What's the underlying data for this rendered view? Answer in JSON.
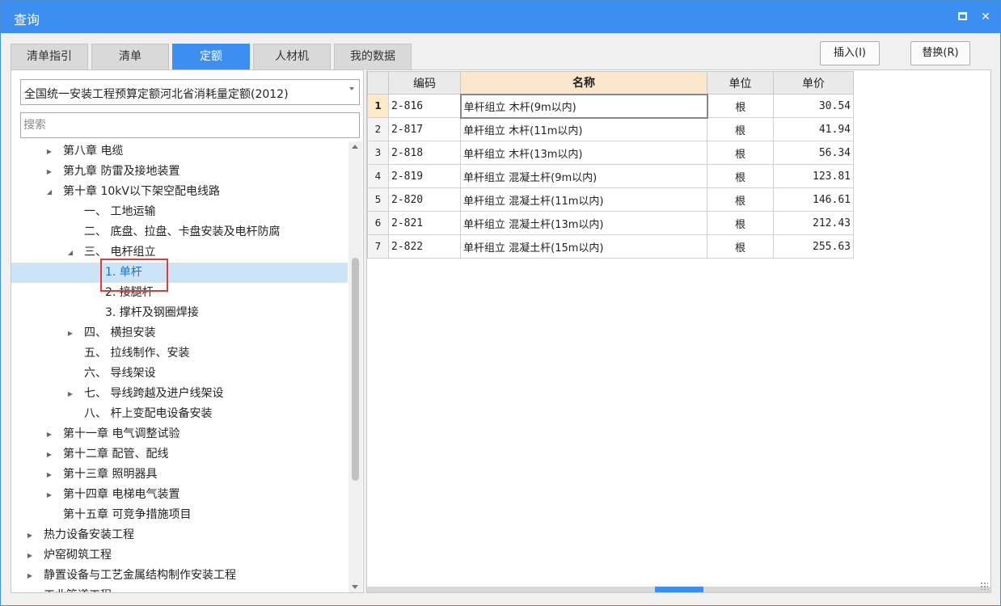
{
  "window": {
    "title": "查询"
  },
  "tabs": [
    {
      "label": "清单指引",
      "active": false
    },
    {
      "label": "清单",
      "active": false
    },
    {
      "label": "定额",
      "active": true
    },
    {
      "label": "人材机",
      "active": false
    },
    {
      "label": "我的数据",
      "active": false
    }
  ],
  "actions": {
    "insert_label": "插入(I)",
    "replace_label": "替换(R)"
  },
  "library": {
    "selected": "全国统一安装工程预算定额河北省消耗量定额(2012)"
  },
  "search": {
    "placeholder": "搜索",
    "value": ""
  },
  "tree": [
    {
      "label": "第八章 电缆",
      "level": 2,
      "toggle": "collapsed"
    },
    {
      "label": "第九章 防雷及接地装置",
      "level": 2,
      "toggle": "collapsed"
    },
    {
      "label": "第十章 10kV以下架空配电线路",
      "level": 2,
      "toggle": "expanded"
    },
    {
      "label": "一、 工地运输",
      "level": 3,
      "toggle": "none"
    },
    {
      "label": "二、 底盘、拉盘、卡盘安装及电杆防腐",
      "level": 3,
      "toggle": "none"
    },
    {
      "label": "三、 电杆组立",
      "level": 3,
      "toggle": "expanded"
    },
    {
      "label": "1. 单杆",
      "level": 4,
      "toggle": "none",
      "selected": true
    },
    {
      "label": "2. 接腿杆",
      "level": 4,
      "toggle": "none"
    },
    {
      "label": "3. 撑杆及钢圈焊接",
      "level": 4,
      "toggle": "none"
    },
    {
      "label": "四、 横担安装",
      "level": 3,
      "toggle": "collapsed"
    },
    {
      "label": "五、 拉线制作、安装",
      "level": 3,
      "toggle": "none"
    },
    {
      "label": "六、 导线架设",
      "level": 3,
      "toggle": "none"
    },
    {
      "label": "七、 导线跨越及进户线架设",
      "level": 3,
      "toggle": "collapsed"
    },
    {
      "label": "八、 杆上变配电设备安装",
      "level": 3,
      "toggle": "none"
    },
    {
      "label": "第十一章 电气调整试验",
      "level": 2,
      "toggle": "collapsed"
    },
    {
      "label": "第十二章 配管、配线",
      "level": 2,
      "toggle": "collapsed"
    },
    {
      "label": "第十三章 照明器具",
      "level": 2,
      "toggle": "collapsed"
    },
    {
      "label": "第十四章 电梯电气装置",
      "level": 2,
      "toggle": "collapsed"
    },
    {
      "label": "第十五章 可竞争措施项目",
      "level": 2,
      "toggle": "none"
    },
    {
      "label": "热力设备安装工程",
      "level": 1,
      "toggle": "collapsed"
    },
    {
      "label": "炉窑砌筑工程",
      "level": 1,
      "toggle": "collapsed"
    },
    {
      "label": "静置设备与工艺金属结构制作安装工程",
      "level": 1,
      "toggle": "collapsed"
    },
    {
      "label": "工业管道工程",
      "level": 1,
      "toggle": "collapsed"
    }
  ],
  "grid": {
    "headers": {
      "code": "编码",
      "name": "名称",
      "unit": "单位",
      "price": "单价"
    },
    "rows": [
      {
        "n": "1",
        "code": "2-816",
        "name": "单杆组立 木杆(9m以内)",
        "unit": "根",
        "price": "30.54"
      },
      {
        "n": "2",
        "code": "2-817",
        "name": "单杆组立 木杆(11m以内)",
        "unit": "根",
        "price": "41.94"
      },
      {
        "n": "3",
        "code": "2-818",
        "name": "单杆组立 木杆(13m以内)",
        "unit": "根",
        "price": "56.34"
      },
      {
        "n": "4",
        "code": "2-819",
        "name": "单杆组立 混凝土杆(9m以内)",
        "unit": "根",
        "price": "123.81"
      },
      {
        "n": "5",
        "code": "2-820",
        "name": "单杆组立 混凝土杆(11m以内)",
        "unit": "根",
        "price": "146.61"
      },
      {
        "n": "6",
        "code": "2-821",
        "name": "单杆组立 混凝土杆(13m以内)",
        "unit": "根",
        "price": "212.43"
      },
      {
        "n": "7",
        "code": "2-822",
        "name": "单杆组立 混凝土杆(15m以内)",
        "unit": "根",
        "price": "255.63"
      }
    ]
  },
  "colors": {
    "accent": "#3c8ff0",
    "selection": "#cce4f7",
    "highlight_box": "#e23b3b",
    "name_header": "#fce6cc"
  }
}
